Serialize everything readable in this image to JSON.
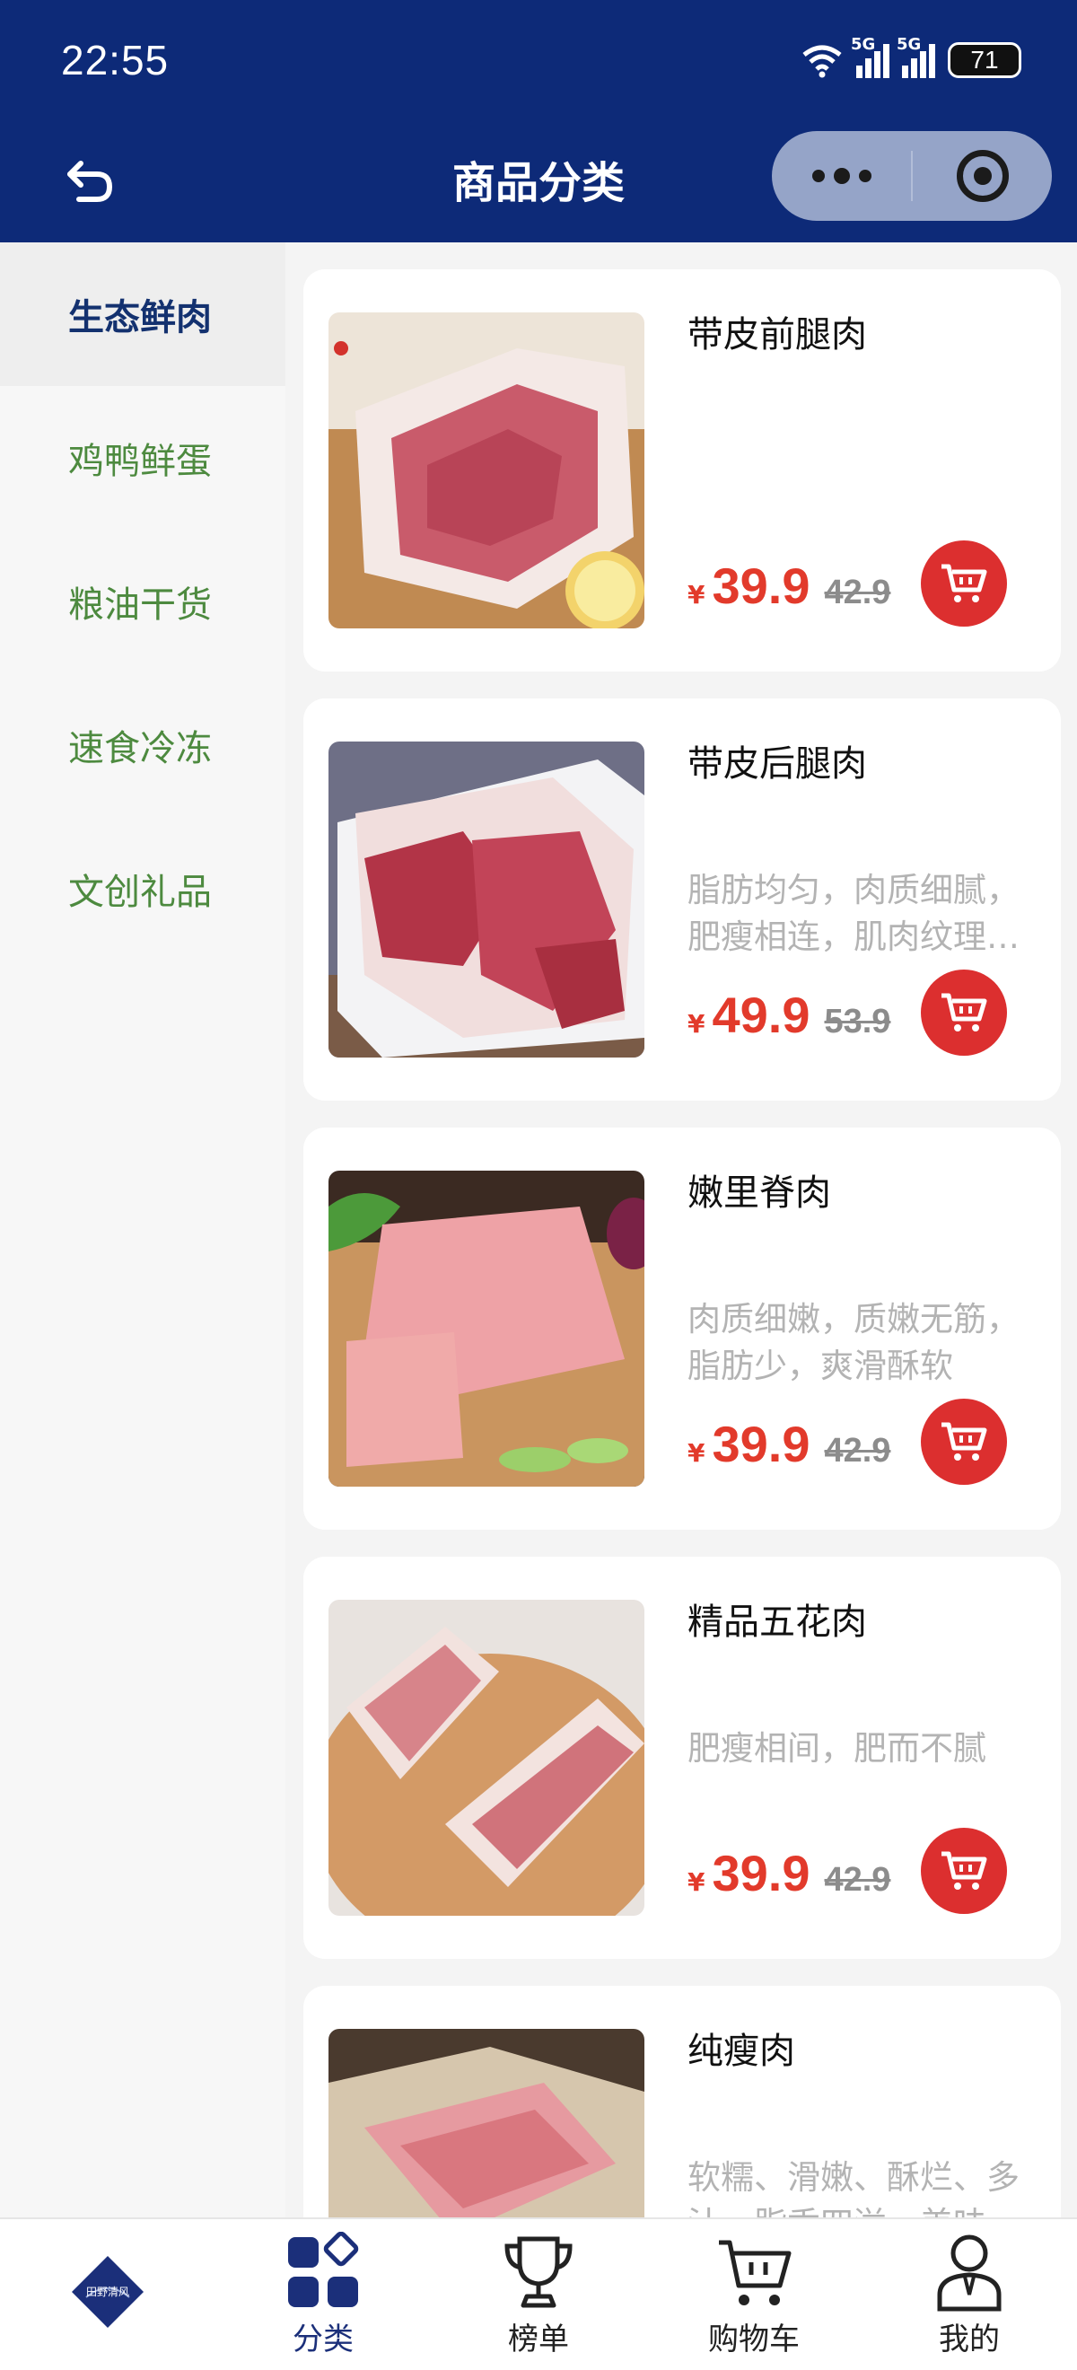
{
  "status_bar": {
    "time": "22:55",
    "net1": "5G",
    "net2": "5G",
    "battery": "71"
  },
  "header": {
    "title": "商品分类"
  },
  "sidebar": {
    "items": [
      {
        "label": "生态鲜肉",
        "active": true
      },
      {
        "label": "鸡鸭鲜蛋"
      },
      {
        "label": "粮油干货"
      },
      {
        "label": "速食冷冻"
      },
      {
        "label": "文创礼品"
      }
    ]
  },
  "products": [
    {
      "name": "带皮前腿肉",
      "desc": "",
      "currency": "¥",
      "price": "39.9",
      "old_price": "42.9"
    },
    {
      "name": "带皮后腿肉",
      "desc": "脂肪均匀，肉质细腻，肥瘦相连，肌肉纹理清晰",
      "currency": "¥",
      "price": "49.9",
      "old_price": "53.9"
    },
    {
      "name": "嫩里脊肉",
      "desc": "肉质细嫩，质嫩无筋，脂肪少，爽滑酥软",
      "currency": "¥",
      "price": "39.9",
      "old_price": "42.9"
    },
    {
      "name": "精品五花肉",
      "desc": "肥瘦相间，肥而不腻",
      "currency": "¥",
      "price": "39.9",
      "old_price": "42.9"
    },
    {
      "name": "纯瘦肉",
      "desc": "软糯、滑嫩、酥烂、多汁，脂香四溢，美味可口",
      "currency": "¥",
      "price": "",
      "old_price": ""
    }
  ],
  "tabbar": {
    "logo_text": "田野清风",
    "items": [
      {
        "label": "分类",
        "icon": "category-icon",
        "active": true
      },
      {
        "label": "榜单",
        "icon": "trophy-icon"
      },
      {
        "label": "购物车",
        "icon": "cart-icon"
      },
      {
        "label": "我的",
        "icon": "user-icon"
      }
    ]
  },
  "colors": {
    "header_bg": "#0d2a78",
    "accent_price": "#e23a2b",
    "cart_button": "#dc2f2f",
    "category_text": "#4d8a3f",
    "active_category": "#13316f"
  }
}
